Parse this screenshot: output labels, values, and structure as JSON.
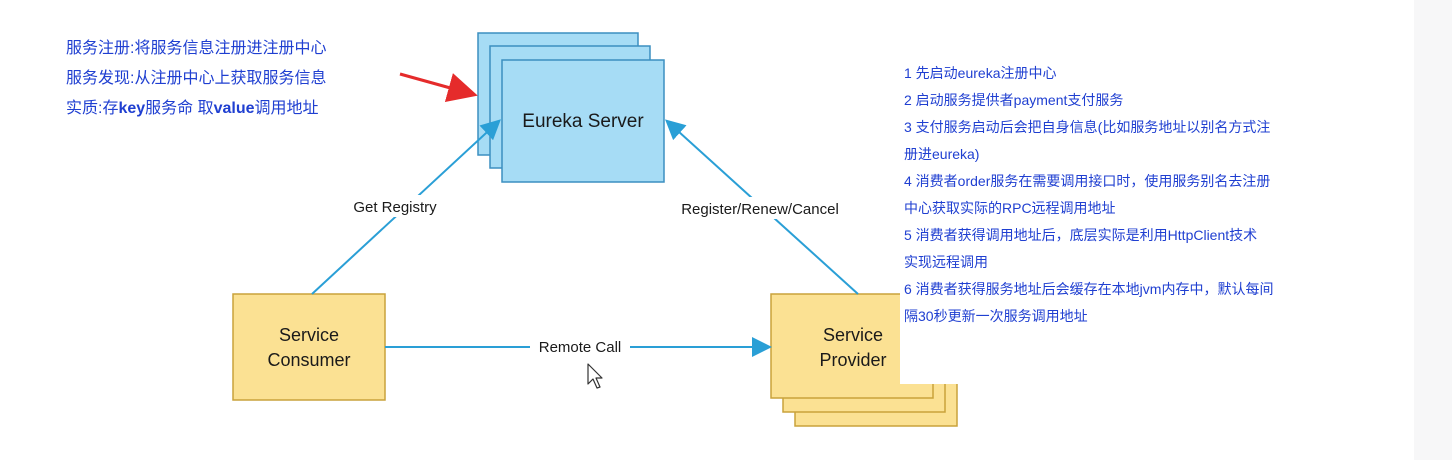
{
  "left_notes": {
    "registration": "服务注册:将服务信息注册进注册中心",
    "discovery": "服务发现:从注册中心上获取服务信息",
    "essence_prefix": "实质:存",
    "essence_key": "key",
    "essence_mid": "服务命 取",
    "essence_value": "value",
    "essence_suffix": "调用地址"
  },
  "nodes": {
    "eureka_server": "Eureka Server",
    "consumer_line1": "Service",
    "consumer_line2": "Consumer",
    "provider_line1": "Service",
    "provider_line2": "Provider"
  },
  "edges": {
    "get_registry": "Get Registry",
    "register_renew_cancel": "Register/Renew/Cancel",
    "remote_call": "Remote Call"
  },
  "steps": [
    "1 先启动eureka注册中心",
    "2 启动服务提供者payment支付服务",
    "3 支付服务启动后会把自身信息(比如服务地址以别名方式注",
    "册进eureka)",
    "4 消费者order服务在需要调用接口时，使用服务别名去注册",
    "中心获取实际的RPC远程调用地址",
    "5 消费者获得调用地址后，底层实际是利用HttpClient技术",
    "实现远程调用",
    "6 消费者获得服务地址后会缓存在本地jvm内存中，默认每间",
    "隔30秒更新一次服务调用地址"
  ],
  "colors": {
    "server_fill": "#a6dcf5",
    "server_stroke": "#3c8fc0",
    "service_fill": "#fbe193",
    "service_stroke": "#c9a23b",
    "arrow": "#2a9fd6",
    "red_arrow": "#e52b2b",
    "text_blue": "#1f3fd1"
  },
  "icons": {
    "cursor": "mouse-pointer-icon"
  }
}
